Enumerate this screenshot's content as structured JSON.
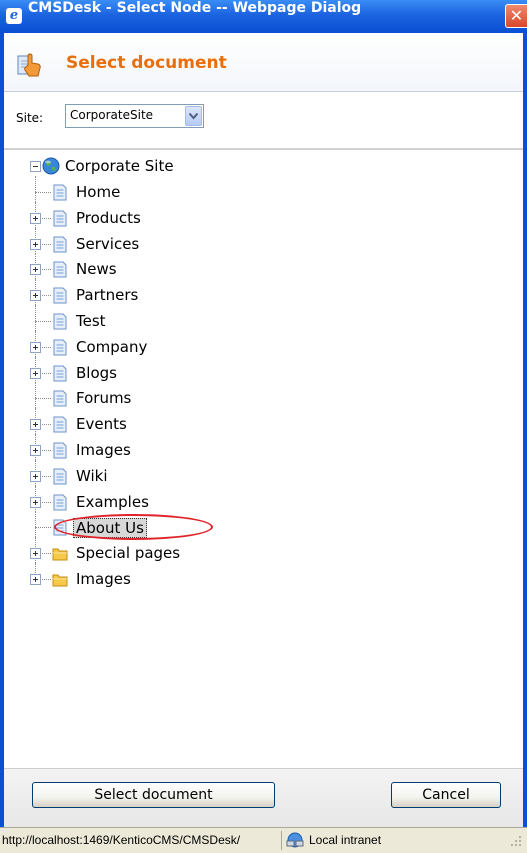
{
  "window": {
    "title": "CMSDesk - Select Node -- Webpage Dialog",
    "close_glyph": "✕"
  },
  "header": {
    "title": "Select document",
    "title_color": "#e96f0c"
  },
  "site": {
    "label": "Site:",
    "selected": "CorporateSite"
  },
  "tree": {
    "root": {
      "label": "Corporate Site",
      "icon": "globe-icon"
    },
    "items": [
      {
        "label": "Home",
        "icon": "page-icon",
        "expandable": false
      },
      {
        "label": "Products",
        "icon": "page-icon",
        "expandable": true
      },
      {
        "label": "Services",
        "icon": "page-icon",
        "expandable": true
      },
      {
        "label": "News",
        "icon": "page-icon",
        "expandable": true
      },
      {
        "label": "Partners",
        "icon": "page-icon",
        "expandable": true
      },
      {
        "label": "Test",
        "icon": "page-icon",
        "expandable": false
      },
      {
        "label": "Company",
        "icon": "page-icon",
        "expandable": true
      },
      {
        "label": "Blogs",
        "icon": "page-icon",
        "expandable": true
      },
      {
        "label": "Forums",
        "icon": "page-icon",
        "expandable": false
      },
      {
        "label": "Events",
        "icon": "page-icon",
        "expandable": true
      },
      {
        "label": "Images",
        "icon": "page-icon",
        "expandable": true
      },
      {
        "label": "Wiki",
        "icon": "page-icon",
        "expandable": true
      },
      {
        "label": "Examples",
        "icon": "page-icon",
        "expandable": true
      },
      {
        "label": "About Us",
        "icon": "page-icon",
        "expandable": false,
        "selected": true
      },
      {
        "label": "Special pages",
        "icon": "folder-icon",
        "expandable": true
      },
      {
        "label": "Images",
        "icon": "folder-icon",
        "expandable": true
      }
    ]
  },
  "footer": {
    "select_label": "Select document",
    "cancel_label": "Cancel"
  },
  "statusbar": {
    "url": "http://localhost:1469/KenticoCMS/CMSDesk/",
    "zone": "Local intranet"
  },
  "colors": {
    "titlebar": "#0a4fd4",
    "annotation": "#e0232a"
  }
}
